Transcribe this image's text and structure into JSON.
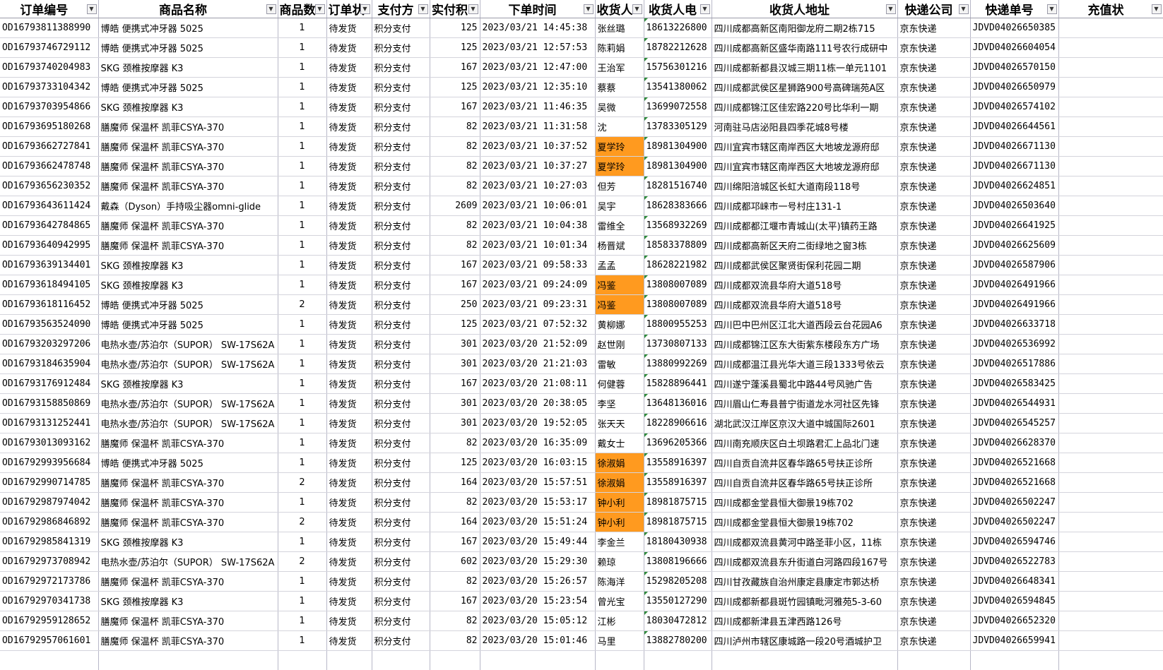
{
  "colors": {
    "highlight": "#ff9a1f",
    "grid": "#b8b8c8",
    "number_indicator": "#2e8b3a"
  },
  "columns": [
    "订单编号",
    "商品名称",
    "商品数",
    "订单状",
    "支付方",
    "实付积",
    "下单时间",
    "收货人",
    "收货人电",
    "收货人地址",
    "快递公司",
    "快递单号",
    "充值状"
  ],
  "filter_icon": "dropdown-arrow-icon",
  "rows": [
    {
      "id": "OD16793811388990",
      "product": "博皓 便携式冲牙器 5025",
      "qty": "1",
      "status": "待发货",
      "pay": "积分支付",
      "points": "125",
      "time": "2023/03/21 14:45:38",
      "name": "张丝璐",
      "phone": "18613226800",
      "addr": "四川成都高新区南阳御龙府二期2栋715",
      "express": "京东快递",
      "track": "JDVD04026650385",
      "hl": false
    },
    {
      "id": "OD16793746729112",
      "product": "博皓 便携式冲牙器 5025",
      "qty": "1",
      "status": "待发货",
      "pay": "积分支付",
      "points": "125",
      "time": "2023/03/21 12:57:53",
      "name": "陈莉娟",
      "phone": "18782212628",
      "addr": "四川成都高新区盛华南路111号农行成研中",
      "express": "京东快递",
      "track": "JDVD04026604054",
      "hl": false
    },
    {
      "id": "OD16793740204983",
      "product": "SKG 颈椎按摩器 K3",
      "qty": "1",
      "status": "待发货",
      "pay": "积分支付",
      "points": "167",
      "time": "2023/03/21 12:47:00",
      "name": "王治军",
      "phone": "15756301216",
      "addr": "四川成都新都县汉城三期11栋一单元1101",
      "express": "京东快递",
      "track": "JDVD04026570150",
      "hl": false
    },
    {
      "id": "OD16793733104342",
      "product": "博皓 便携式冲牙器 5025",
      "qty": "1",
      "status": "待发货",
      "pay": "积分支付",
      "points": "125",
      "time": "2023/03/21 12:35:10",
      "name": "蔡蔡",
      "phone": "13541380062",
      "addr": "四川成都武侯区星狮路900号高碑瑞苑A区",
      "express": "京东快递",
      "track": "JDVD04026650979",
      "hl": false
    },
    {
      "id": "OD16793703954866",
      "product": "SKG 颈椎按摩器 K3",
      "qty": "1",
      "status": "待发货",
      "pay": "积分支付",
      "points": "167",
      "time": "2023/03/21 11:46:35",
      "name": "吴微",
      "phone": "13699072558",
      "addr": "四川成都锦江区佳宏路220号比华利一期",
      "express": "京东快递",
      "track": "JDVD04026574102",
      "hl": false
    },
    {
      "id": "OD16793695180268",
      "product": "膳魔师 保温杯 凯菲CSYA-370",
      "qty": "1",
      "status": "待发货",
      "pay": "积分支付",
      "points": "82",
      "time": "2023/03/21 11:31:58",
      "name": "沈",
      "phone": "13783305129",
      "addr": "河南驻马店泌阳县四季花城8号楼",
      "express": "京东快递",
      "track": "JDVD04026644561",
      "hl": false
    },
    {
      "id": "OD16793662727841",
      "product": "膳魔师 保温杯 凯菲CSYA-370",
      "qty": "1",
      "status": "待发货",
      "pay": "积分支付",
      "points": "82",
      "time": "2023/03/21 10:37:52",
      "name": "夏学玲",
      "phone": "18981304900",
      "addr": "四川宜宾市辖区南岸西区大地坡龙源府邸",
      "express": "京东快递",
      "track": "JDVD04026671130",
      "hl": true
    },
    {
      "id": "OD16793662478748",
      "product": "膳魔师 保温杯 凯菲CSYA-370",
      "qty": "1",
      "status": "待发货",
      "pay": "积分支付",
      "points": "82",
      "time": "2023/03/21 10:37:27",
      "name": "夏学玲",
      "phone": "18981304900",
      "addr": "四川宜宾市辖区南岸西区大地坡龙源府邸",
      "express": "京东快递",
      "track": "JDVD04026671130",
      "hl": true
    },
    {
      "id": "OD16793656230352",
      "product": "膳魔师 保温杯 凯菲CSYA-370",
      "qty": "1",
      "status": "待发货",
      "pay": "积分支付",
      "points": "82",
      "time": "2023/03/21 10:27:03",
      "name": "但芳",
      "phone": "18281516740",
      "addr": "四川绵阳涪城区长虹大道南段118号",
      "express": "京东快递",
      "track": "JDVD04026624851",
      "hl": false
    },
    {
      "id": "OD16793643611424",
      "product": "戴森（Dyson）手持吸尘器omni-glide",
      "qty": "1",
      "status": "待发货",
      "pay": "积分支付",
      "points": "2609",
      "time": "2023/03/21 10:06:01",
      "name": "吴宇",
      "phone": "18628383666",
      "addr": "四川成都邛崃市一号村庄131-1",
      "express": "京东快递",
      "track": "JDVD04026503640",
      "hl": false
    },
    {
      "id": "OD16793642784865",
      "product": "膳魔师 保温杯 凯菲CSYA-370",
      "qty": "1",
      "status": "待发货",
      "pay": "积分支付",
      "points": "82",
      "time": "2023/03/21 10:04:38",
      "name": "雷维全",
      "phone": "13568932269",
      "addr": "四川成都都江堰市青城山(太平)镇药王路",
      "express": "京东快递",
      "track": "JDVD04026641925",
      "hl": false
    },
    {
      "id": "OD16793640942995",
      "product": "膳魔师 保温杯 凯菲CSYA-370",
      "qty": "1",
      "status": "待发货",
      "pay": "积分支付",
      "points": "82",
      "time": "2023/03/21 10:01:34",
      "name": "杨晋斌",
      "phone": "18583378809",
      "addr": "四川成都高新区天府二街绿地之窗3栋",
      "express": "京东快递",
      "track": "JDVD04026625609",
      "hl": false
    },
    {
      "id": "OD16793639134401",
      "product": "SKG 颈椎按摩器 K3",
      "qty": "1",
      "status": "待发货",
      "pay": "积分支付",
      "points": "167",
      "time": "2023/03/21 09:58:33",
      "name": "孟孟",
      "phone": "18628221982",
      "addr": "四川成都武侯区聚贤街保利花园二期",
      "express": "京东快递",
      "track": "JDVD04026587906",
      "hl": false
    },
    {
      "id": "OD16793618494105",
      "product": "SKG 颈椎按摩器 K3",
      "qty": "1",
      "status": "待发货",
      "pay": "积分支付",
      "points": "167",
      "time": "2023/03/21 09:24:09",
      "name": "冯鉴",
      "phone": "13808007089",
      "addr": "四川成都双流县华府大道518号",
      "express": "京东快递",
      "track": "JDVD04026491966",
      "hl": true
    },
    {
      "id": "OD16793618116452",
      "product": "博皓 便携式冲牙器 5025",
      "qty": "2",
      "status": "待发货",
      "pay": "积分支付",
      "points": "250",
      "time": "2023/03/21 09:23:31",
      "name": "冯鉴",
      "phone": "13808007089",
      "addr": "四川成都双流县华府大道518号",
      "express": "京东快递",
      "track": "JDVD04026491966",
      "hl": true
    },
    {
      "id": "OD16793563524090",
      "product": "博皓 便携式冲牙器 5025",
      "qty": "1",
      "status": "待发货",
      "pay": "积分支付",
      "points": "125",
      "time": "2023/03/21 07:52:32",
      "name": "黄柳娜",
      "phone": "18800955253",
      "addr": "四川巴中巴州区江北大道西段云台花园A6",
      "express": "京东快递",
      "track": "JDVD04026633718",
      "hl": false
    },
    {
      "id": "OD16793203297206",
      "product": "电热水壶/苏泊尔（SUPOR） SW-17S62A",
      "qty": "1",
      "status": "待发货",
      "pay": "积分支付",
      "points": "301",
      "time": "2023/03/20 21:52:09",
      "name": "赵世刚",
      "phone": "13730807133",
      "addr": "四川成都锦江区东大街紫东楼段东方广场",
      "express": "京东快递",
      "track": "JDVD04026536992",
      "hl": false
    },
    {
      "id": "OD16793184635904",
      "product": "电热水壶/苏泊尔（SUPOR） SW-17S62A",
      "qty": "1",
      "status": "待发货",
      "pay": "积分支付",
      "points": "301",
      "time": "2023/03/20 21:21:03",
      "name": "雷敏",
      "phone": "13880992269",
      "addr": "四川成都温江县光华大道三段1333号依云",
      "express": "京东快递",
      "track": "JDVD04026517886",
      "hl": false
    },
    {
      "id": "OD16793176912484",
      "product": "SKG 颈椎按摩器 K3",
      "qty": "1",
      "status": "待发货",
      "pay": "积分支付",
      "points": "167",
      "time": "2023/03/20 21:08:11",
      "name": "何健蓉",
      "phone": "15828896441",
      "addr": "四川遂宁蓬溪县蜀北中路44号风驰广告",
      "express": "京东快递",
      "track": "JDVD04026583425",
      "hl": false
    },
    {
      "id": "OD16793158850869",
      "product": "电热水壶/苏泊尔（SUPOR） SW-17S62A",
      "qty": "1",
      "status": "待发货",
      "pay": "积分支付",
      "points": "301",
      "time": "2023/03/20 20:38:05",
      "name": "李坚",
      "phone": "13648136016",
      "addr": "四川眉山仁寿县普宁街道龙水河社区先锋",
      "express": "京东快递",
      "track": "JDVD04026544931",
      "hl": false
    },
    {
      "id": "OD16793131252441",
      "product": "电热水壶/苏泊尔（SUPOR） SW-17S62A",
      "qty": "1",
      "status": "待发货",
      "pay": "积分支付",
      "points": "301",
      "time": "2023/03/20 19:52:05",
      "name": "张天天",
      "phone": "18228906616",
      "addr": "湖北武汉江岸区京汉大道中城国际2601",
      "express": "京东快递",
      "track": "JDVD04026545257",
      "hl": false
    },
    {
      "id": "OD16793013093162",
      "product": "膳魔师 保温杯 凯菲CSYA-370",
      "qty": "1",
      "status": "待发货",
      "pay": "积分支付",
      "points": "82",
      "time": "2023/03/20 16:35:09",
      "name": "戴女士",
      "phone": "13696205366",
      "addr": "四川南充顺庆区白土坝路君汇上品北门速",
      "express": "京东快递",
      "track": "JDVD04026628370",
      "hl": false
    },
    {
      "id": "OD16792993956684",
      "product": "博皓 便携式冲牙器 5025",
      "qty": "1",
      "status": "待发货",
      "pay": "积分支付",
      "points": "125",
      "time": "2023/03/20 16:03:15",
      "name": "徐淑娟",
      "phone": "13558916397",
      "addr": "四川自贡自流井区春华路65号扶正诊所",
      "express": "京东快递",
      "track": "JDVD04026521668",
      "hl": true
    },
    {
      "id": "OD16792990714785",
      "product": "膳魔师 保温杯 凯菲CSYA-370",
      "qty": "2",
      "status": "待发货",
      "pay": "积分支付",
      "points": "164",
      "time": "2023/03/20 15:57:51",
      "name": "徐淑娟",
      "phone": "13558916397",
      "addr": "四川自贡自流井区春华路65号扶正诊所",
      "express": "京东快递",
      "track": "JDVD04026521668",
      "hl": true
    },
    {
      "id": "OD16792987974042",
      "product": "膳魔师 保温杯 凯菲CSYA-370",
      "qty": "1",
      "status": "待发货",
      "pay": "积分支付",
      "points": "82",
      "time": "2023/03/20 15:53:17",
      "name": "钟小利",
      "phone": "18981875715",
      "addr": "四川成都金堂县恒大御景19栋702",
      "express": "京东快递",
      "track": "JDVD04026502247",
      "hl": true
    },
    {
      "id": "OD16792986846892",
      "product": "膳魔师 保温杯 凯菲CSYA-370",
      "qty": "2",
      "status": "待发货",
      "pay": "积分支付",
      "points": "164",
      "time": "2023/03/20 15:51:24",
      "name": "钟小利",
      "phone": "18981875715",
      "addr": "四川成都金堂县恒大御景19栋702",
      "express": "京东快递",
      "track": "JDVD04026502247",
      "hl": true
    },
    {
      "id": "OD16792985841319",
      "product": "SKG 颈椎按摩器 K3",
      "qty": "1",
      "status": "待发货",
      "pay": "积分支付",
      "points": "167",
      "time": "2023/03/20 15:49:44",
      "name": "李金兰",
      "phone": "18180430938",
      "addr": "四川成都双流县黄河中路圣菲小区，11栋",
      "express": "京东快递",
      "track": "JDVD04026594746",
      "hl": false
    },
    {
      "id": "OD16792973708942",
      "product": "电热水壶/苏泊尔（SUPOR） SW-17S62A",
      "qty": "2",
      "status": "待发货",
      "pay": "积分支付",
      "points": "602",
      "time": "2023/03/20 15:29:30",
      "name": "赖琼",
      "phone": "13808196666",
      "addr": "四川成都双流县东升街道白河路四段167号",
      "express": "京东快递",
      "track": "JDVD04026522783",
      "hl": false
    },
    {
      "id": "OD16792972173786",
      "product": "膳魔师 保温杯 凯菲CSYA-370",
      "qty": "1",
      "status": "待发货",
      "pay": "积分支付",
      "points": "82",
      "time": "2023/03/20 15:26:57",
      "name": "陈海洋",
      "phone": "15298205208",
      "addr": "四川甘孜藏族自治州康定县康定市郭达桥",
      "express": "京东快递",
      "track": "JDVD04026648341",
      "hl": false
    },
    {
      "id": "OD16792970341738",
      "product": "SKG 颈椎按摩器 K3",
      "qty": "1",
      "status": "待发货",
      "pay": "积分支付",
      "points": "167",
      "time": "2023/03/20 15:23:54",
      "name": "曾光宝",
      "phone": "13550127290",
      "addr": "四川成都新都县斑竹园镇毗河雅苑5-3-60",
      "express": "京东快递",
      "track": "JDVD04026594845",
      "hl": false
    },
    {
      "id": "OD16792959128652",
      "product": "膳魔师 保温杯 凯菲CSYA-370",
      "qty": "1",
      "status": "待发货",
      "pay": "积分支付",
      "points": "82",
      "time": "2023/03/20 15:05:12",
      "name": "江彬",
      "phone": "18030472812",
      "addr": "四川成都新津县五津西路126号",
      "express": "京东快递",
      "track": "JDVD04026652320",
      "hl": false
    },
    {
      "id": "OD16792957061601",
      "product": "膳魔师 保温杯 凯菲CSYA-370",
      "qty": "1",
      "status": "待发货",
      "pay": "积分支付",
      "points": "82",
      "time": "2023/03/20 15:01:46",
      "name": "马里",
      "phone": "13882780200",
      "addr": "四川泸州市辖区康城路一段20号酒城护卫",
      "express": "京东快递",
      "track": "JDVD04026659941",
      "hl": false
    }
  ]
}
